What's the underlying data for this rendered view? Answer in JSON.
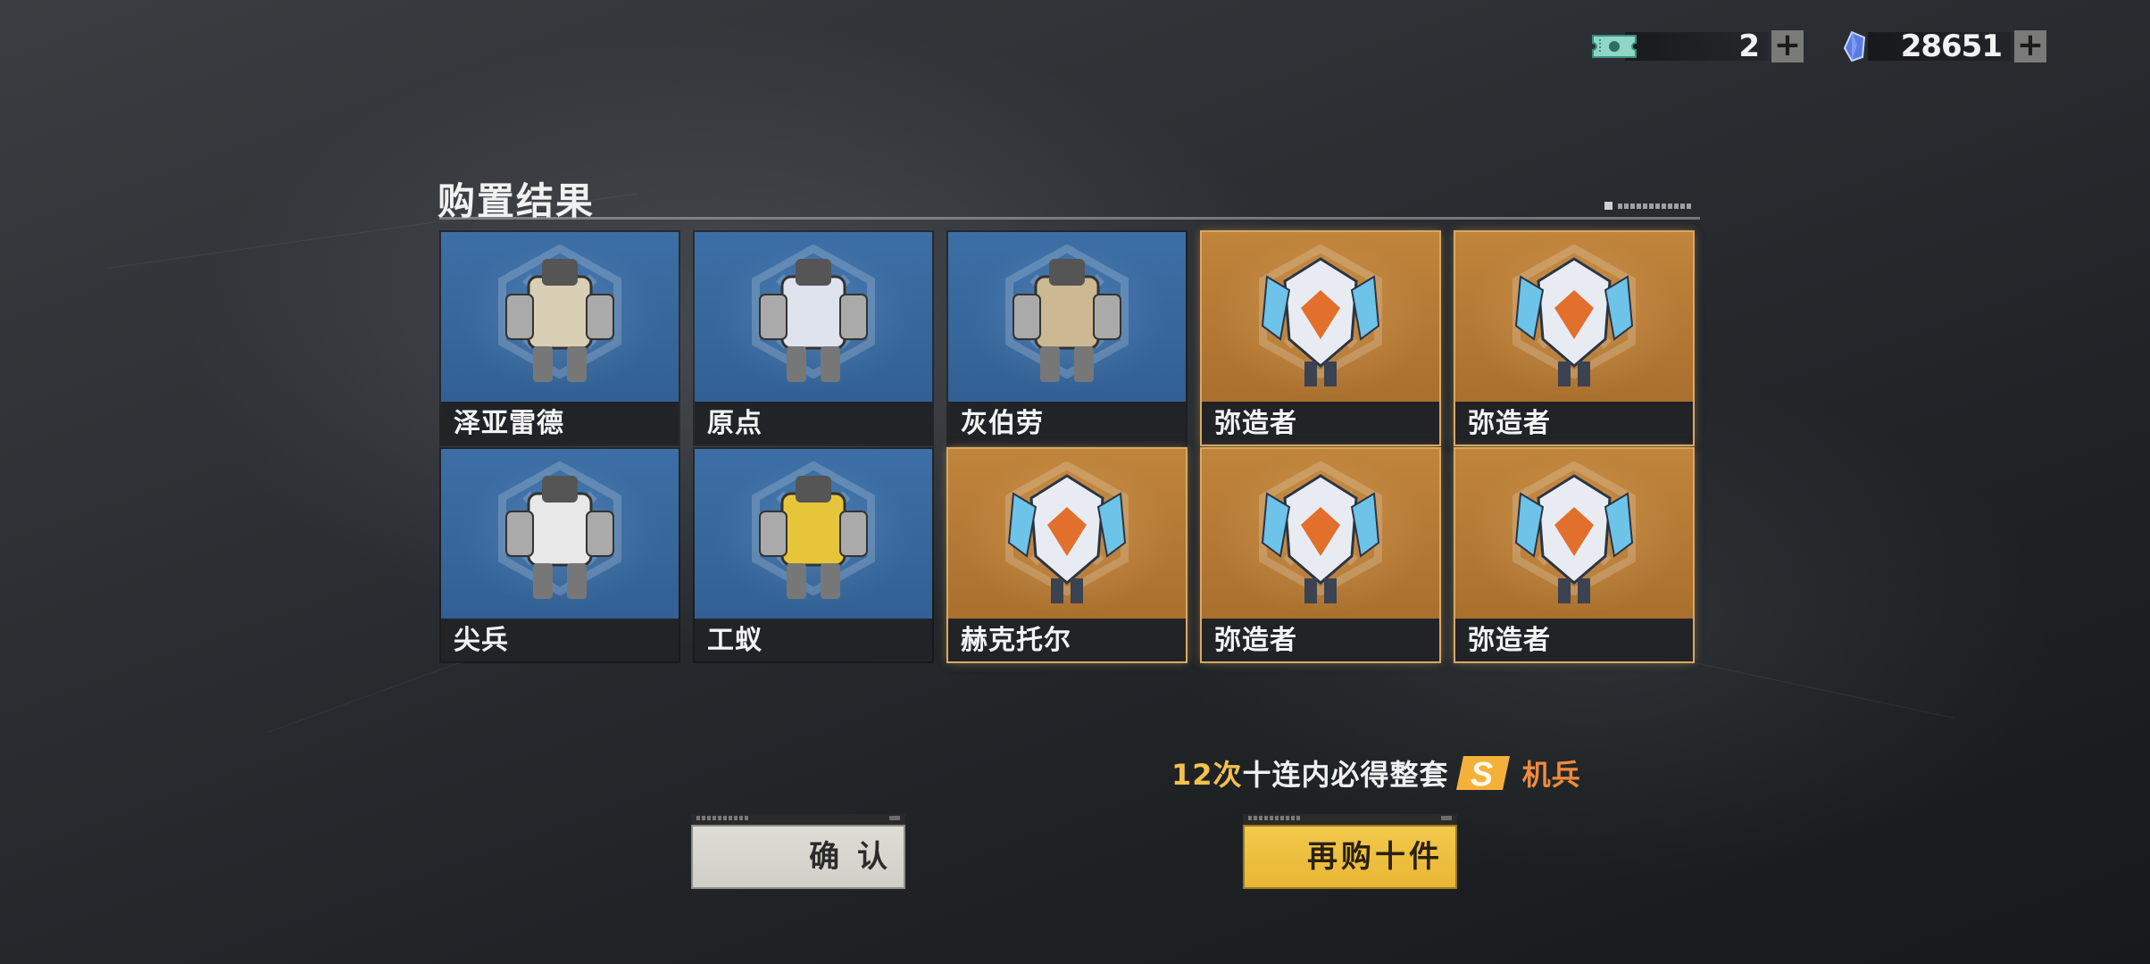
{
  "currency": {
    "ticket_count": "2",
    "crystal_count": "28651",
    "ticket_icon": "ticket-icon",
    "crystal_icon": "crystal-icon"
  },
  "header": {
    "title": "购置结果"
  },
  "results": [
    {
      "name": "泽亚雷德",
      "rarity": "blue",
      "icon": "mech-torso-tan-icon"
    },
    {
      "name": "原点",
      "rarity": "blue",
      "icon": "mech-head-white-icon"
    },
    {
      "name": "灰伯劳",
      "rarity": "blue",
      "icon": "mech-arm-tan-icon"
    },
    {
      "name": "弥造者",
      "rarity": "gold",
      "icon": "mech-torso-orange-icon"
    },
    {
      "name": "弥造者",
      "rarity": "gold",
      "icon": "mech-arm-orange-icon"
    },
    {
      "name": "尖兵",
      "rarity": "blue",
      "icon": "mech-legs-white-icon"
    },
    {
      "name": "工蚁",
      "rarity": "blue",
      "icon": "mech-yellow-frame-icon"
    },
    {
      "name": "赫克托尔",
      "rarity": "gold",
      "icon": "mech-head-navy-icon"
    },
    {
      "name": "弥造者",
      "rarity": "gold",
      "icon": "mech-arm-orange-icon"
    },
    {
      "name": "弥造者",
      "rarity": "gold",
      "icon": "mech-legs-orange-icon"
    }
  ],
  "guarantee": {
    "count": "12次",
    "text": "十连内必得整套",
    "badge": "S",
    "suffix": "机兵"
  },
  "buttons": {
    "confirm": "确 认",
    "buy_again": "再购十件"
  },
  "colors": {
    "blue_card": "#3c6fa6",
    "gold_card": "#c0843c",
    "accent_yellow": "#f2c14e",
    "accent_orange": "#f08a3c"
  }
}
